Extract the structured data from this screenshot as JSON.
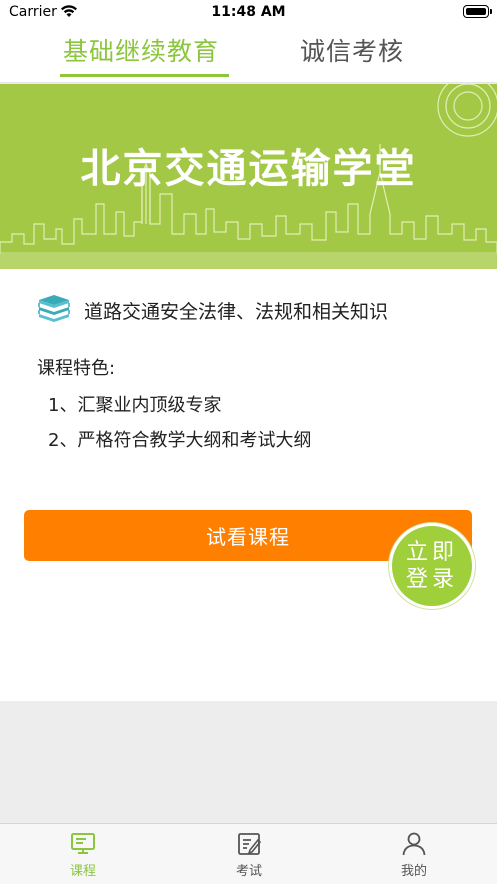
{
  "status_bar": {
    "carrier": "Carrier",
    "time": "11:48 AM"
  },
  "top_tabs": [
    {
      "label": "基础继续教育",
      "active": true
    },
    {
      "label": "诚信考核",
      "active": false
    }
  ],
  "banner": {
    "title": "北京交通运输学堂"
  },
  "course": {
    "title": "道路交通安全法律、法规和相关知识",
    "features_label": "课程特色:",
    "features": [
      "1、汇聚业内顶级专家",
      "2、严格符合教学大纲和考试大纲"
    ],
    "trial_button": "试看课程"
  },
  "login_badge": {
    "line1": "立即",
    "line2": "登录"
  },
  "tab_bar": [
    {
      "label": "课程",
      "icon": "course-icon",
      "active": true
    },
    {
      "label": "考试",
      "icon": "exam-icon",
      "active": false
    },
    {
      "label": "我的",
      "icon": "profile-icon",
      "active": false
    }
  ],
  "colors": {
    "accent_green": "#8cc63f",
    "banner_green": "#a3c845",
    "orange": "#ff8000"
  }
}
